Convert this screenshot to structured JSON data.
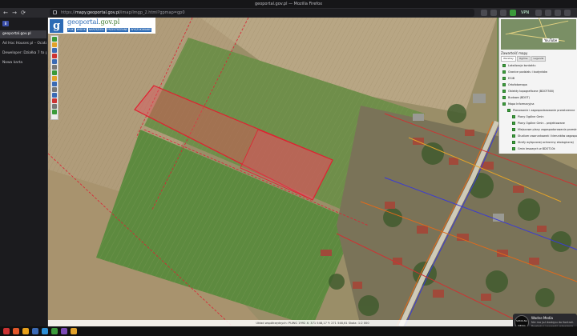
{
  "window": {
    "title": "geoportal.gov.pl — Mozilla Firefox"
  },
  "browser": {
    "url_prefix": "https://",
    "url_host": "mapy.geoportal.gov.pl",
    "url_path": "/imap/Imgp_2.html?gpmap=gp0",
    "vpn_label": "VPN",
    "nav": {
      "back": "←",
      "forward": "→",
      "reload": "⟳"
    }
  },
  "sidebar": {
    "badge": "B",
    "tabs": [
      {
        "label": "geoportal.gov.pl",
        "active": true
      },
      {
        "label": "Ad Hoc Houses pl – Ocatanonni Serwis",
        "active": false
      },
      {
        "label": "Deweloper: Działka 7 to pod zabudo",
        "active": false
      },
      {
        "label": "Nowa karta",
        "active": false
      }
    ]
  },
  "geoportal": {
    "logo_letter": "g",
    "title_main": "geoportal",
    "title_domain": ".gov.pl",
    "menu": [
      "PLIK",
      "WIDOK",
      "NARZĘDZIA",
      "PRZESTRZENNE",
      "WYSZUKIWANIE"
    ]
  },
  "toolbar_tools": [
    "#3a9a3a",
    "#e2a22a",
    "#3a6ab5",
    "#c33",
    "#3a6ab5",
    "#777",
    "#3a9a3a",
    "#e2a22a",
    "#3a6ab5",
    "#777",
    "#3a6ab5",
    "#c33",
    "#777",
    "#3a9a3a"
  ],
  "panel": {
    "youtube_label": "YouTube",
    "heading": "Zawartość mapy",
    "tabs": [
      "Warstwy",
      "Ogólne",
      "Legenda"
    ],
    "layers": [
      {
        "label": "Lokalizacja kontaktu",
        "indent": 0
      },
      {
        "label": "Granice podziału i budynków",
        "indent": 0
      },
      {
        "label": "EGiB",
        "indent": 0
      },
      {
        "label": "Ortofotomapa",
        "indent": 0
      },
      {
        "label": "Obiekty topograficzne (BDOT500)",
        "indent": 0
      },
      {
        "label": "Budowa (BDOT)",
        "indent": 0
      },
      {
        "label": "Mapa Informacyjna",
        "indent": 0
      },
      {
        "label": "Planowanie i zagospodarowanie przestrzenne",
        "indent": 1
      },
      {
        "label": "Plany Ogólne Gmin",
        "indent": 2
      },
      {
        "label": "Plany Ogólne Gmin - projektowane",
        "indent": 2
      },
      {
        "label": "Miejscowe plany zagospodarowania przestrzennego",
        "indent": 2
      },
      {
        "label": "Studium uwarunkowań i kierunków zagospodarowania",
        "indent": 2
      },
      {
        "label": "Strefy wyłączonej ochroniny ekologicznej",
        "indent": 2
      },
      {
        "label": "Gmin lesowych w BDOT10k",
        "indent": 2
      },
      {
        "label": "Plansze mapowe",
        "indent": 1
      }
    ]
  },
  "status": {
    "text": "Układ współrzędnych: PUWG 1992  X: 371 548,17  Y: 271 548,61  Skala: 1:2 000"
  },
  "notification": {
    "badge_top": "SZKOLNA",
    "badge_bottom": "MEDIA",
    "title": "Wodne Media",
    "body": "Nie ma już dostępu do Kontroli. Przeładuj i sprawdź ustawienia"
  },
  "taskbar_icons": [
    "#c33",
    "#e2572a",
    "#e8a01a",
    "#3a6ab5",
    "#2d8fd5",
    "#3a9a3a",
    "#7a4ab5",
    "#e2a22a"
  ]
}
